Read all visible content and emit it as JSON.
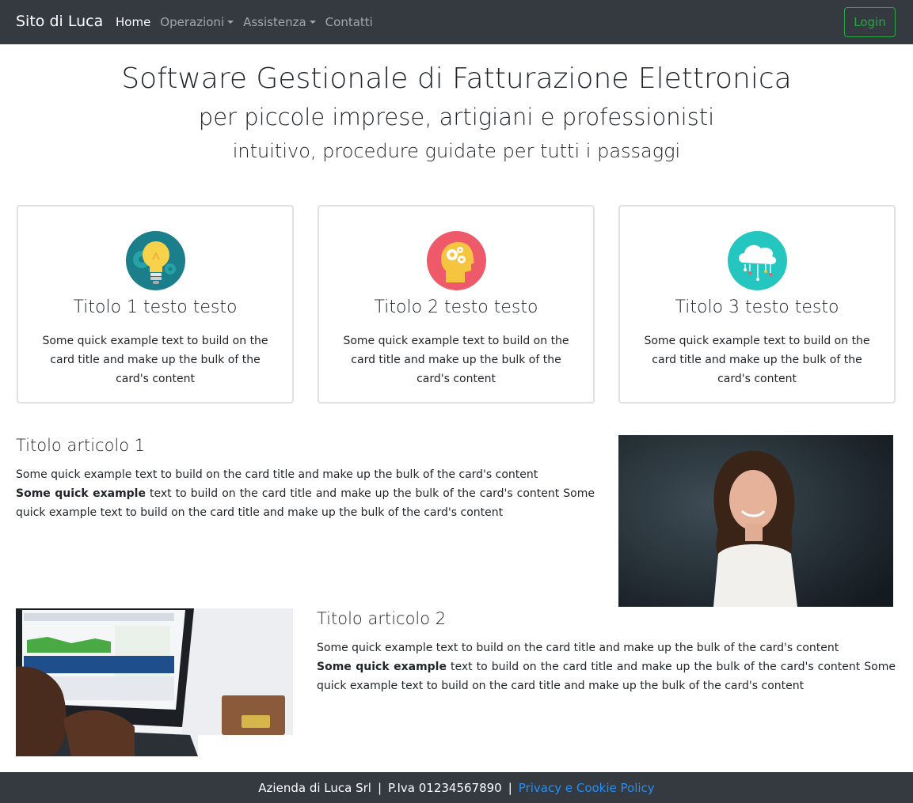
{
  "navbar": {
    "brand": "Sito di Luca",
    "items": [
      {
        "label": "Home"
      },
      {
        "label": "Operazioni"
      },
      {
        "label": "Assistenza"
      },
      {
        "label": "Contatti"
      }
    ],
    "login_label": "Login"
  },
  "hero": {
    "title": "Software Gestionale di Fatturazione Elettronica",
    "subtitle1": "per piccole imprese, artigiani e professionisti",
    "subtitle2": "intuitivo, procedure guidate per tutti i passaggi"
  },
  "cards": [
    {
      "title": "Titolo 1 testo testo",
      "text": "Some quick example text to build on the card title and make up the bulk of the card's content",
      "icon": "lightbulb-gear-icon"
    },
    {
      "title": "Titolo 2 testo testo",
      "text": "Some quick example text to build on the card title and make up the bulk of the card's content",
      "icon": "head-gears-icon"
    },
    {
      "title": "Titolo 3 testo testo",
      "text": "Some quick example text to build on the card title and make up the bulk of the card's content",
      "icon": "cloud-network-icon"
    }
  ],
  "articles": [
    {
      "title": "Titolo articolo 1",
      "line1": "Some quick example text to build on the card title and make up the bulk of the card's content",
      "bold": "Some quick example",
      "rest": " text to build on the card title and make up the bulk of the card's content Some quick example text to build on the card title and make up the bulk of the card's content"
    },
    {
      "title": "Titolo articolo 2",
      "line1": "Some quick example text to build on the card title and make up the bulk of the card's content",
      "bold": "Some quick example",
      "rest": " text to build on the card title and make up the bulk of the card's content Some quick example text to build on the card title and make up the bulk of the card's content"
    }
  ],
  "footer": {
    "company": "Azienda di Luca Srl",
    "sep": "|",
    "vat": "P.Iva 01234567890",
    "policy_link": "Privacy e Cookie Policy"
  },
  "colors": {
    "navbar_bg": "#343a40",
    "login_green": "#28a745",
    "link_blue": "#1e90ff"
  }
}
